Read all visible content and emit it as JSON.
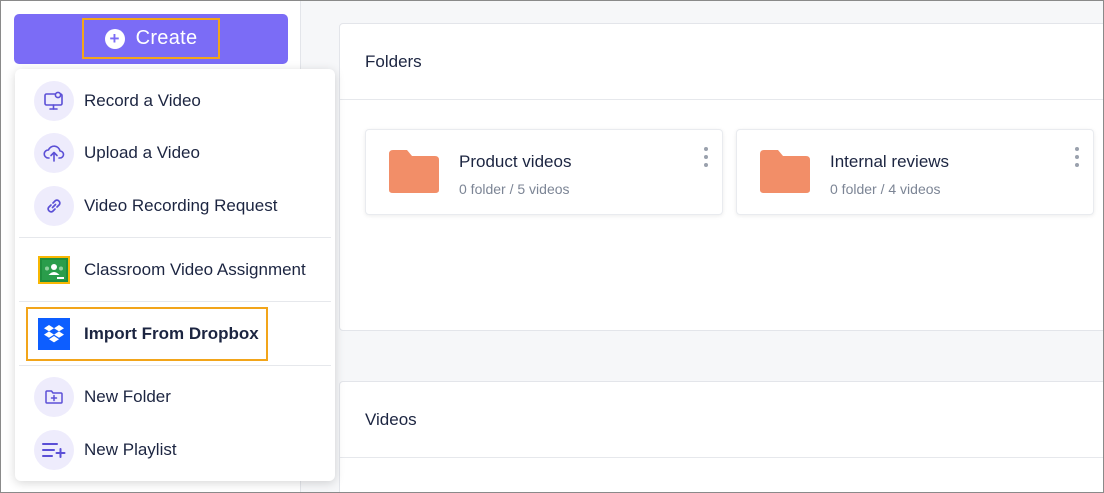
{
  "create": {
    "label": "Create"
  },
  "menu": {
    "items": [
      {
        "label": "Record a Video",
        "icon": "monitor-record-icon"
      },
      {
        "label": "Upload a Video",
        "icon": "cloud-upload-icon"
      },
      {
        "label": "Video Recording Request",
        "icon": "link-icon"
      },
      {
        "label": "Classroom Video Assignment",
        "icon": "google-classroom-icon"
      },
      {
        "label": "Import From Dropbox",
        "icon": "dropbox-icon"
      },
      {
        "label": "New Folder",
        "icon": "folder-plus-icon"
      },
      {
        "label": "New Playlist",
        "icon": "playlist-add-icon"
      }
    ]
  },
  "folders_section": {
    "title": "Folders",
    "folders": [
      {
        "name": "Product videos",
        "meta": "0 folder / 5 videos"
      },
      {
        "name": "Internal reviews",
        "meta": "0 folder / 4 videos"
      }
    ]
  },
  "videos_section": {
    "title": "Videos"
  },
  "colors": {
    "accent": "#7b6cf6",
    "highlight": "#f2a51a",
    "folder": "#f28e68",
    "dropbox": "#0d5eff",
    "classroom": "#1e8e3e"
  }
}
